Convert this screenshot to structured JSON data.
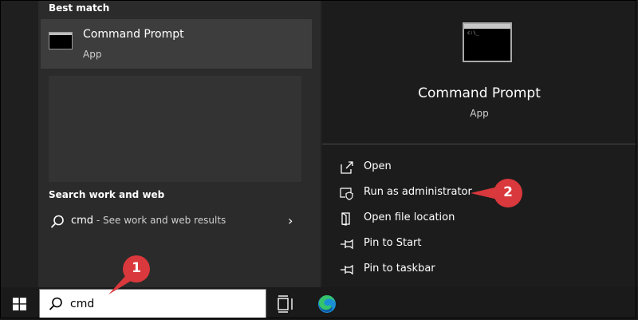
{
  "left": {
    "best_match_heading": "Best match",
    "best_match": {
      "title": "Command Prompt",
      "subtitle": "App",
      "icon": "command-prompt-icon"
    },
    "web_heading": "Search work and web",
    "web_result": {
      "query": "cmd",
      "suffix": " - See work and web results"
    }
  },
  "right": {
    "title": "Command Prompt",
    "subtitle": "App",
    "actions": [
      {
        "label": "Open",
        "icon": "open-icon"
      },
      {
        "label": "Run as administrator",
        "icon": "shield-icon"
      },
      {
        "label": "Open file location",
        "icon": "folder-icon"
      },
      {
        "label": "Pin to Start",
        "icon": "pin-icon"
      },
      {
        "label": "Pin to taskbar",
        "icon": "pin-icon"
      }
    ]
  },
  "taskbar": {
    "search_value": "cmd"
  },
  "callouts": [
    {
      "number": "1"
    },
    {
      "number": "2"
    }
  ],
  "colors": {
    "callout": "#d9383c",
    "panel": "#2b2b2b",
    "right_panel": "#1c1c1c",
    "taskbar": "#1a1a1a"
  }
}
